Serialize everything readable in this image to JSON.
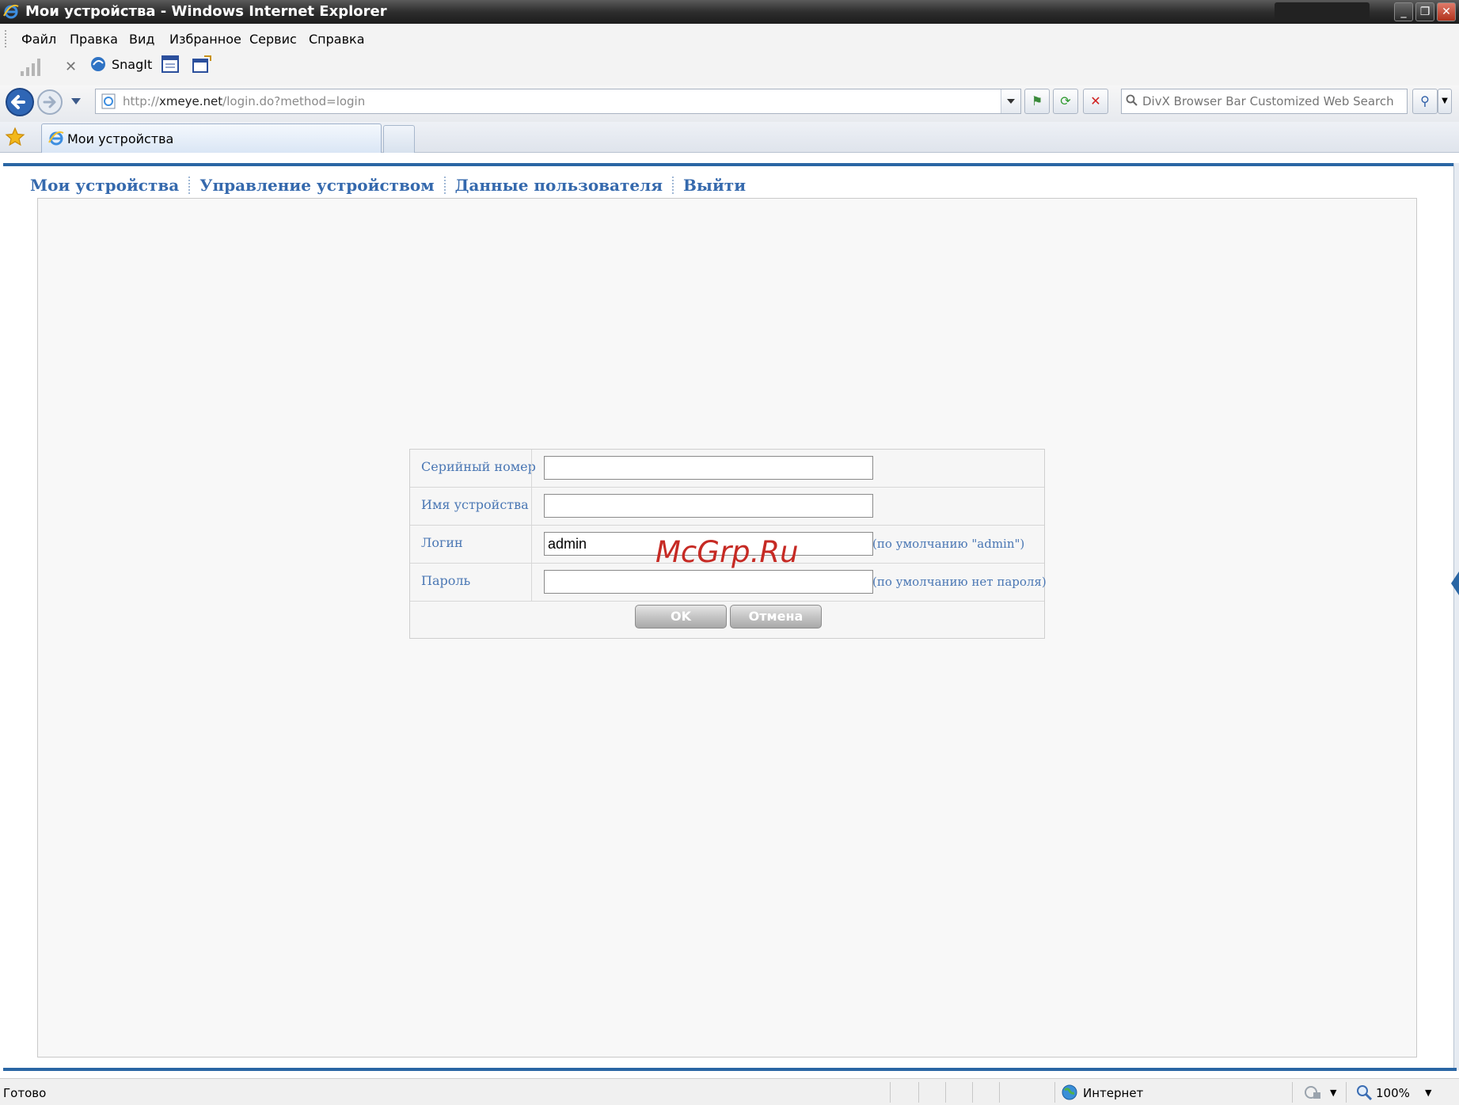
{
  "window": {
    "title": "Мои устройства - Windows Internet Explorer"
  },
  "menu": [
    "Файл",
    "Правка",
    "Вид",
    "Избранное",
    "Сервис",
    "Справка"
  ],
  "toolbar": {
    "snagit_label": "SnagIt"
  },
  "address_bar": {
    "prefix": "http://",
    "host": "xmeye.net",
    "path": "/login.do?method=login"
  },
  "search": {
    "placeholder": "DivX Browser Bar Customized Web Search"
  },
  "tab": {
    "title": "Мои устройства"
  },
  "site_nav": [
    "Мои устройства",
    "Управление устройством",
    "Данные пользователя",
    "Выйти"
  ],
  "form": {
    "serial_label": "Серийный номер",
    "serial_value": "",
    "device_name_label": "Имя устройства",
    "device_name_value": "",
    "login_label": "Логин",
    "login_value": "admin",
    "login_hint": "(по умолчанию \"admin\")",
    "password_label": "Пароль",
    "password_value": "",
    "password_hint": "(по умолчанию нет пароля)",
    "ok_label": "OK",
    "cancel_label": "Отмена"
  },
  "watermark": "McGrp.Ru",
  "status_bar": {
    "status": "Готово",
    "zone": "Интернет",
    "zoom": "100%"
  },
  "colors": {
    "link_blue": "#3569ad",
    "accent_line": "#2a66a4",
    "watermark_red": "#c62a24"
  }
}
